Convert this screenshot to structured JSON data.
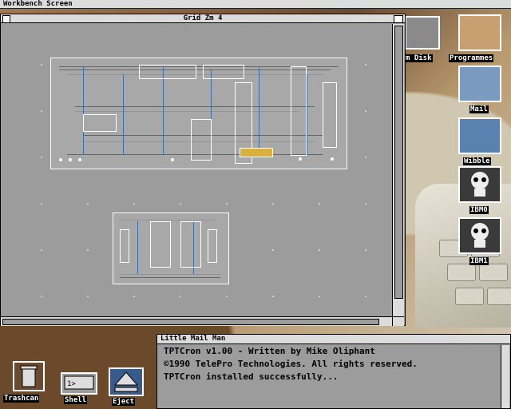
{
  "screen": {
    "title": "Workbench Screen"
  },
  "main_window": {
    "title": "Grid  Zm 4"
  },
  "right_icons": [
    {
      "label": "m Disk"
    },
    {
      "label": "Programmes"
    },
    {
      "label": "Mail"
    },
    {
      "label": "Wibble"
    },
    {
      "label": "IBM0"
    },
    {
      "label": "IBM1"
    }
  ],
  "bottom_icons": [
    {
      "label": "Trashcan"
    },
    {
      "label": "Shell"
    },
    {
      "label": "Eject"
    }
  ],
  "shell_window": {
    "title": "Little Mail Man",
    "lines": [
      "TPTCron v1.00 - Written by Mike Oliphant",
      "©1990 TelePro Technologies. All rights reserved.",
      "TPTCron installed successfully..."
    ]
  },
  "colors": {
    "workbench_grey": "#9c9c9c",
    "trace_blue": "#3b6ea8",
    "trace_orange": "#c88a3a",
    "title_bar": "#dcdcdc"
  }
}
